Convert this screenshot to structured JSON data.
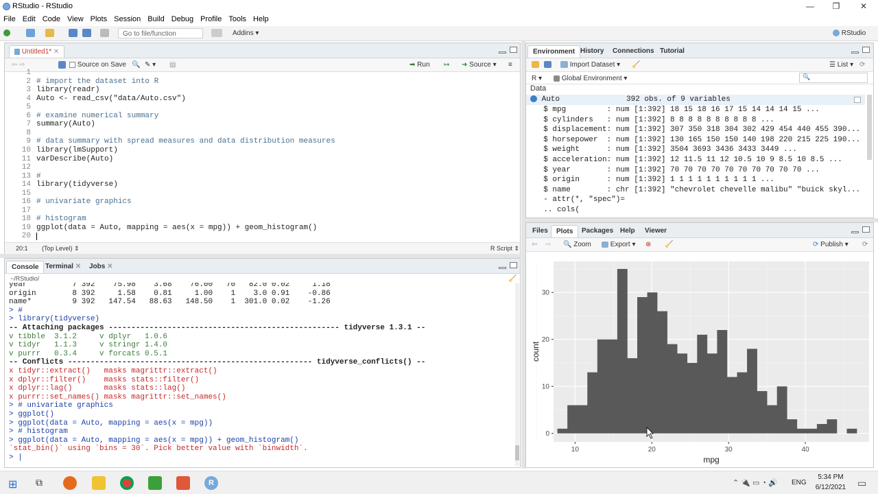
{
  "window": {
    "title": "RStudio - RStudio",
    "minimize": "—",
    "maximize": "❐",
    "close": "✕"
  },
  "menu": [
    "File",
    "Edit",
    "Code",
    "View",
    "Plots",
    "Session",
    "Build",
    "Debug",
    "Profile",
    "Tools",
    "Help"
  ],
  "toolbar": {
    "goto_placeholder": "Go to file/function",
    "addins": "Addins",
    "project": "RStudio"
  },
  "editor": {
    "tab": "Untitled1*",
    "source_on_save": "Source on Save",
    "run": "Run",
    "source": "Source",
    "lines": [
      {
        "n": "1",
        "t": "",
        "c": "code"
      },
      {
        "n": "2",
        "t": "# import the dataset into R",
        "c": "comment"
      },
      {
        "n": "3",
        "t": "library(readr)",
        "c": "code"
      },
      {
        "n": "4",
        "t": "Auto <- read_csv(\"data/Auto.csv\")",
        "c": "code"
      },
      {
        "n": "5",
        "t": "",
        "c": "code"
      },
      {
        "n": "6",
        "t": "# examine numerical summary",
        "c": "comment"
      },
      {
        "n": "7",
        "t": "summary(Auto)",
        "c": "code"
      },
      {
        "n": "8",
        "t": "",
        "c": "code"
      },
      {
        "n": "9",
        "t": "# data summary with spread measures and data distribution measures",
        "c": "comment"
      },
      {
        "n": "10",
        "t": "library(lmSupport)",
        "c": "code"
      },
      {
        "n": "11",
        "t": "varDescribe(Auto)",
        "c": "code"
      },
      {
        "n": "12",
        "t": "",
        "c": "code"
      },
      {
        "n": "13",
        "t": "#",
        "c": "comment"
      },
      {
        "n": "14",
        "t": "library(tidyverse)",
        "c": "code"
      },
      {
        "n": "15",
        "t": "",
        "c": "code"
      },
      {
        "n": "16",
        "t": "# univariate graphics",
        "c": "comment"
      },
      {
        "n": "17",
        "t": "",
        "c": "code"
      },
      {
        "n": "18",
        "t": "# histogram",
        "c": "comment"
      },
      {
        "n": "19",
        "t": "ggplot(data = Auto, mapping = aes(x = mpg)) + geom_histogram()",
        "c": "code"
      },
      {
        "n": "20",
        "t": "",
        "c": "code"
      }
    ],
    "status_pos": "20:1",
    "status_scope": "(Top Level) ⇕",
    "status_type": "R Script ⇕"
  },
  "console": {
    "tabs": [
      "Console",
      "Terminal",
      "Jobs"
    ],
    "path": "~/RStudio/",
    "lines": [
      {
        "t": "year          7 392    75.98    3.68    76.00   70   82.0 0.02     1.18",
        "c": ""
      },
      {
        "t": "origin        8 392     1.58    0.81     1.00    1    3.0 0.91    -0.86",
        "c": ""
      },
      {
        "t": "name*         9 392   147.54   88.63   148.50    1  301.0 0.02    -1.26",
        "c": ""
      },
      {
        "t": "> #",
        "c": "blue"
      },
      {
        "t": "> library(tidyverse)",
        "c": "blue"
      },
      {
        "t": "-- Attaching packages --------------------------------------------------- tidyverse 1.3.1 --",
        "c": "bold"
      },
      {
        "t": "v tibble  3.1.2     v dplyr   1.0.6",
        "c": "grn"
      },
      {
        "t": "v tidyr   1.1.3     v stringr 1.4.0",
        "c": "grn"
      },
      {
        "t": "v purrr   0.3.4     v forcats 0.5.1",
        "c": "grn"
      },
      {
        "t": "-- Conflicts ------------------------------------------------------ tidyverse_conflicts() --",
        "c": "bold"
      },
      {
        "t": "x tidyr::extract()   masks magrittr::extract()",
        "c": "red"
      },
      {
        "t": "x dplyr::filter()    masks stats::filter()",
        "c": "red"
      },
      {
        "t": "x dplyr::lag()       masks stats::lag()",
        "c": "red"
      },
      {
        "t": "x purrr::set_names() masks magrittr::set_names()",
        "c": "red"
      },
      {
        "t": "> # univariate graphics",
        "c": "blue"
      },
      {
        "t": "> ggplot()",
        "c": "blue"
      },
      {
        "t": "> ggplot(data = Auto, mapping = aes(x = mpg))",
        "c": "blue"
      },
      {
        "t": "> # histogram",
        "c": "blue"
      },
      {
        "t": "> ggplot(data = Auto, mapping = aes(x = mpg)) + geom_histogram()",
        "c": "blue"
      },
      {
        "t": "`stat_bin()` using `bins = 30`. Pick better value with `binwidth`.",
        "c": "red"
      },
      {
        "t": "> |",
        "c": "blue"
      }
    ]
  },
  "environment": {
    "tabs": [
      "Environment",
      "History",
      "Connections",
      "Tutorial"
    ],
    "import_dataset": "Import Dataset",
    "list_label": "List",
    "lang": "R",
    "scope": "Global Environment",
    "section": "Data",
    "object": "Auto",
    "object_desc": "392 obs. of 9 variables",
    "rows": [
      "  $ mpg         : num [1:392] 18 15 18 16 17 15 14 14 14 15 ...",
      "  $ cylinders   : num [1:392] 8 8 8 8 8 8 8 8 8 8 ...",
      "  $ displacement: num [1:392] 307 350 318 304 302 429 454 440 455 390...",
      "  $ horsepower  : num [1:392] 130 165 150 150 140 198 220 215 225 190...",
      "  $ weight      : num [1:392] 3504 3693 3436 3433 3449 ...",
      "  $ acceleration: num [1:392] 12 11.5 11 12 10.5 10 9 8.5 10 8.5 ...",
      "  $ year        : num [1:392] 70 70 70 70 70 70 70 70 70 70 ...",
      "  $ origin      : num [1:392] 1 1 1 1 1 1 1 1 1 1 ...",
      "  $ name        : chr [1:392] \"chevrolet chevelle malibu\" \"buick skyl...",
      "  - attr(*, \"spec\")=",
      "  .. cols("
    ]
  },
  "plots": {
    "tabs": [
      "Files",
      "Plots",
      "Packages",
      "Help",
      "Viewer"
    ],
    "zoom": "Zoom",
    "export": "Export",
    "publish": "Publish"
  },
  "chart_data": {
    "type": "bar",
    "title": "",
    "xlabel": "mpg",
    "ylabel": "count",
    "xlim": [
      7.2,
      48.3
    ],
    "ylim": [
      -1.8,
      36.6
    ],
    "xticks": [
      10,
      20,
      30,
      40
    ],
    "yticks": [
      0,
      10,
      20,
      30
    ],
    "bin_start": 7.7,
    "bin_width": 1.3,
    "values": [
      1,
      6,
      6,
      13,
      20,
      20,
      35,
      16,
      29,
      30,
      26,
      19,
      17,
      15,
      21,
      17,
      22,
      12,
      13,
      18,
      9,
      6,
      10,
      3,
      1,
      1,
      2,
      3,
      0,
      1
    ],
    "fill": "#595959",
    "panel_bg": "#ebebeb",
    "grid": true
  },
  "taskbar": {
    "lang": "ENG",
    "time": "5:34 PM",
    "date": "6/12/2021"
  }
}
